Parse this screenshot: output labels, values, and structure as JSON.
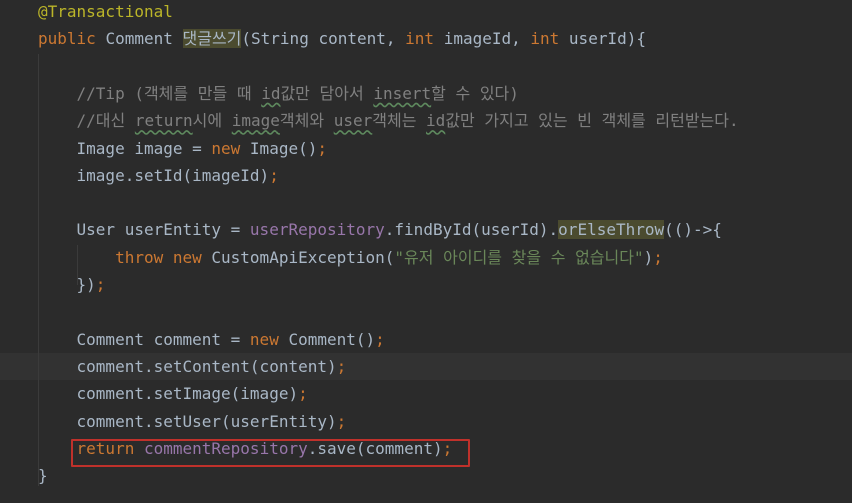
{
  "editor": {
    "lines": [
      {
        "tokens": [
          {
            "t": "@Transactional",
            "c": "ann"
          }
        ]
      },
      {
        "tokens": [
          {
            "t": "public ",
            "c": "kw"
          },
          {
            "t": "Comment ",
            "c": ""
          },
          {
            "t": "댓글쓰기",
            "c": "hl2"
          },
          {
            "t": "(String content, ",
            "c": ""
          },
          {
            "t": "int ",
            "c": "kw"
          },
          {
            "t": "imageId, ",
            "c": ""
          },
          {
            "t": "int ",
            "c": "kw"
          },
          {
            "t": "userId){",
            "c": ""
          }
        ]
      },
      {
        "tokens": []
      },
      {
        "tokens": [
          {
            "t": "    //Tip (객체를 만들 때 ",
            "c": "cm"
          },
          {
            "t": "id",
            "c": "cm typo"
          },
          {
            "t": "값만 담아서 ",
            "c": "cm"
          },
          {
            "t": "insert",
            "c": "cm typo"
          },
          {
            "t": "할 수 있다)",
            "c": "cm"
          }
        ]
      },
      {
        "tokens": [
          {
            "t": "    //대신 ",
            "c": "cm"
          },
          {
            "t": "return",
            "c": "cm typo"
          },
          {
            "t": "시에 ",
            "c": "cm"
          },
          {
            "t": "image",
            "c": "cm typo"
          },
          {
            "t": "객체와 ",
            "c": "cm"
          },
          {
            "t": "user",
            "c": "cm typo"
          },
          {
            "t": "객체는 ",
            "c": "cm"
          },
          {
            "t": "id",
            "c": "cm typo"
          },
          {
            "t": "값만 가지고 있는 빈 객체를 리턴받는다.",
            "c": "cm"
          }
        ]
      },
      {
        "tokens": [
          {
            "t": "    Image image = ",
            "c": ""
          },
          {
            "t": "new ",
            "c": "kw"
          },
          {
            "t": "Image()",
            "c": ""
          },
          {
            "t": ";",
            "c": "kw"
          }
        ]
      },
      {
        "tokens": [
          {
            "t": "    image.setId(imageId)",
            "c": ""
          },
          {
            "t": ";",
            "c": "kw"
          }
        ]
      },
      {
        "tokens": []
      },
      {
        "tokens": [
          {
            "t": "    User userEntity = ",
            "c": ""
          },
          {
            "t": "userRepository",
            "c": "fld"
          },
          {
            "t": ".findById(userId).",
            "c": ""
          },
          {
            "t": "orElseThrow",
            "c": "hl2"
          },
          {
            "t": "(()->{",
            "c": ""
          }
        ]
      },
      {
        "tokens": [
          {
            "t": "        ",
            "c": ""
          },
          {
            "t": "throw new ",
            "c": "kw"
          },
          {
            "t": "CustomApiException(",
            "c": ""
          },
          {
            "t": "\"유저 아이디를 찾을 수 없습니다\"",
            "c": "str"
          },
          {
            "t": ")",
            "c": ""
          },
          {
            "t": ";",
            "c": "kw"
          }
        ]
      },
      {
        "tokens": [
          {
            "t": "    })",
            "c": ""
          },
          {
            "t": ";",
            "c": "kw"
          }
        ]
      },
      {
        "tokens": []
      },
      {
        "tokens": [
          {
            "t": "    Comment comment = ",
            "c": ""
          },
          {
            "t": "new ",
            "c": "kw"
          },
          {
            "t": "Comment()",
            "c": ""
          },
          {
            "t": ";",
            "c": "kw"
          }
        ]
      },
      {
        "tokens": [
          {
            "t": "    comment.setContent(content)",
            "c": ""
          },
          {
            "t": ";",
            "c": "kw"
          }
        ]
      },
      {
        "tokens": [
          {
            "t": "    comment.setImage(image)",
            "c": ""
          },
          {
            "t": ";",
            "c": "kw"
          }
        ]
      },
      {
        "tokens": [
          {
            "t": "    comment.setUser(userEntity)",
            "c": ""
          },
          {
            "t": ";",
            "c": "kw"
          }
        ]
      },
      {
        "tokens": [
          {
            "t": "    ",
            "c": ""
          },
          {
            "t": "return ",
            "c": "kw"
          },
          {
            "t": "commentRepository",
            "c": "fld"
          },
          {
            "t": ".save(comment)",
            "c": ""
          },
          {
            "t": ";",
            "c": "kw"
          }
        ]
      },
      {
        "tokens": [
          {
            "t": "}",
            "c": ""
          }
        ]
      }
    ]
  },
  "colors": {
    "background": "#2b2b2b",
    "keyword": "#cc7832",
    "annotation": "#bbb529",
    "comment": "#808080",
    "string": "#6a8759",
    "field": "#9876aa",
    "highlight_box": "#c0312b"
  }
}
